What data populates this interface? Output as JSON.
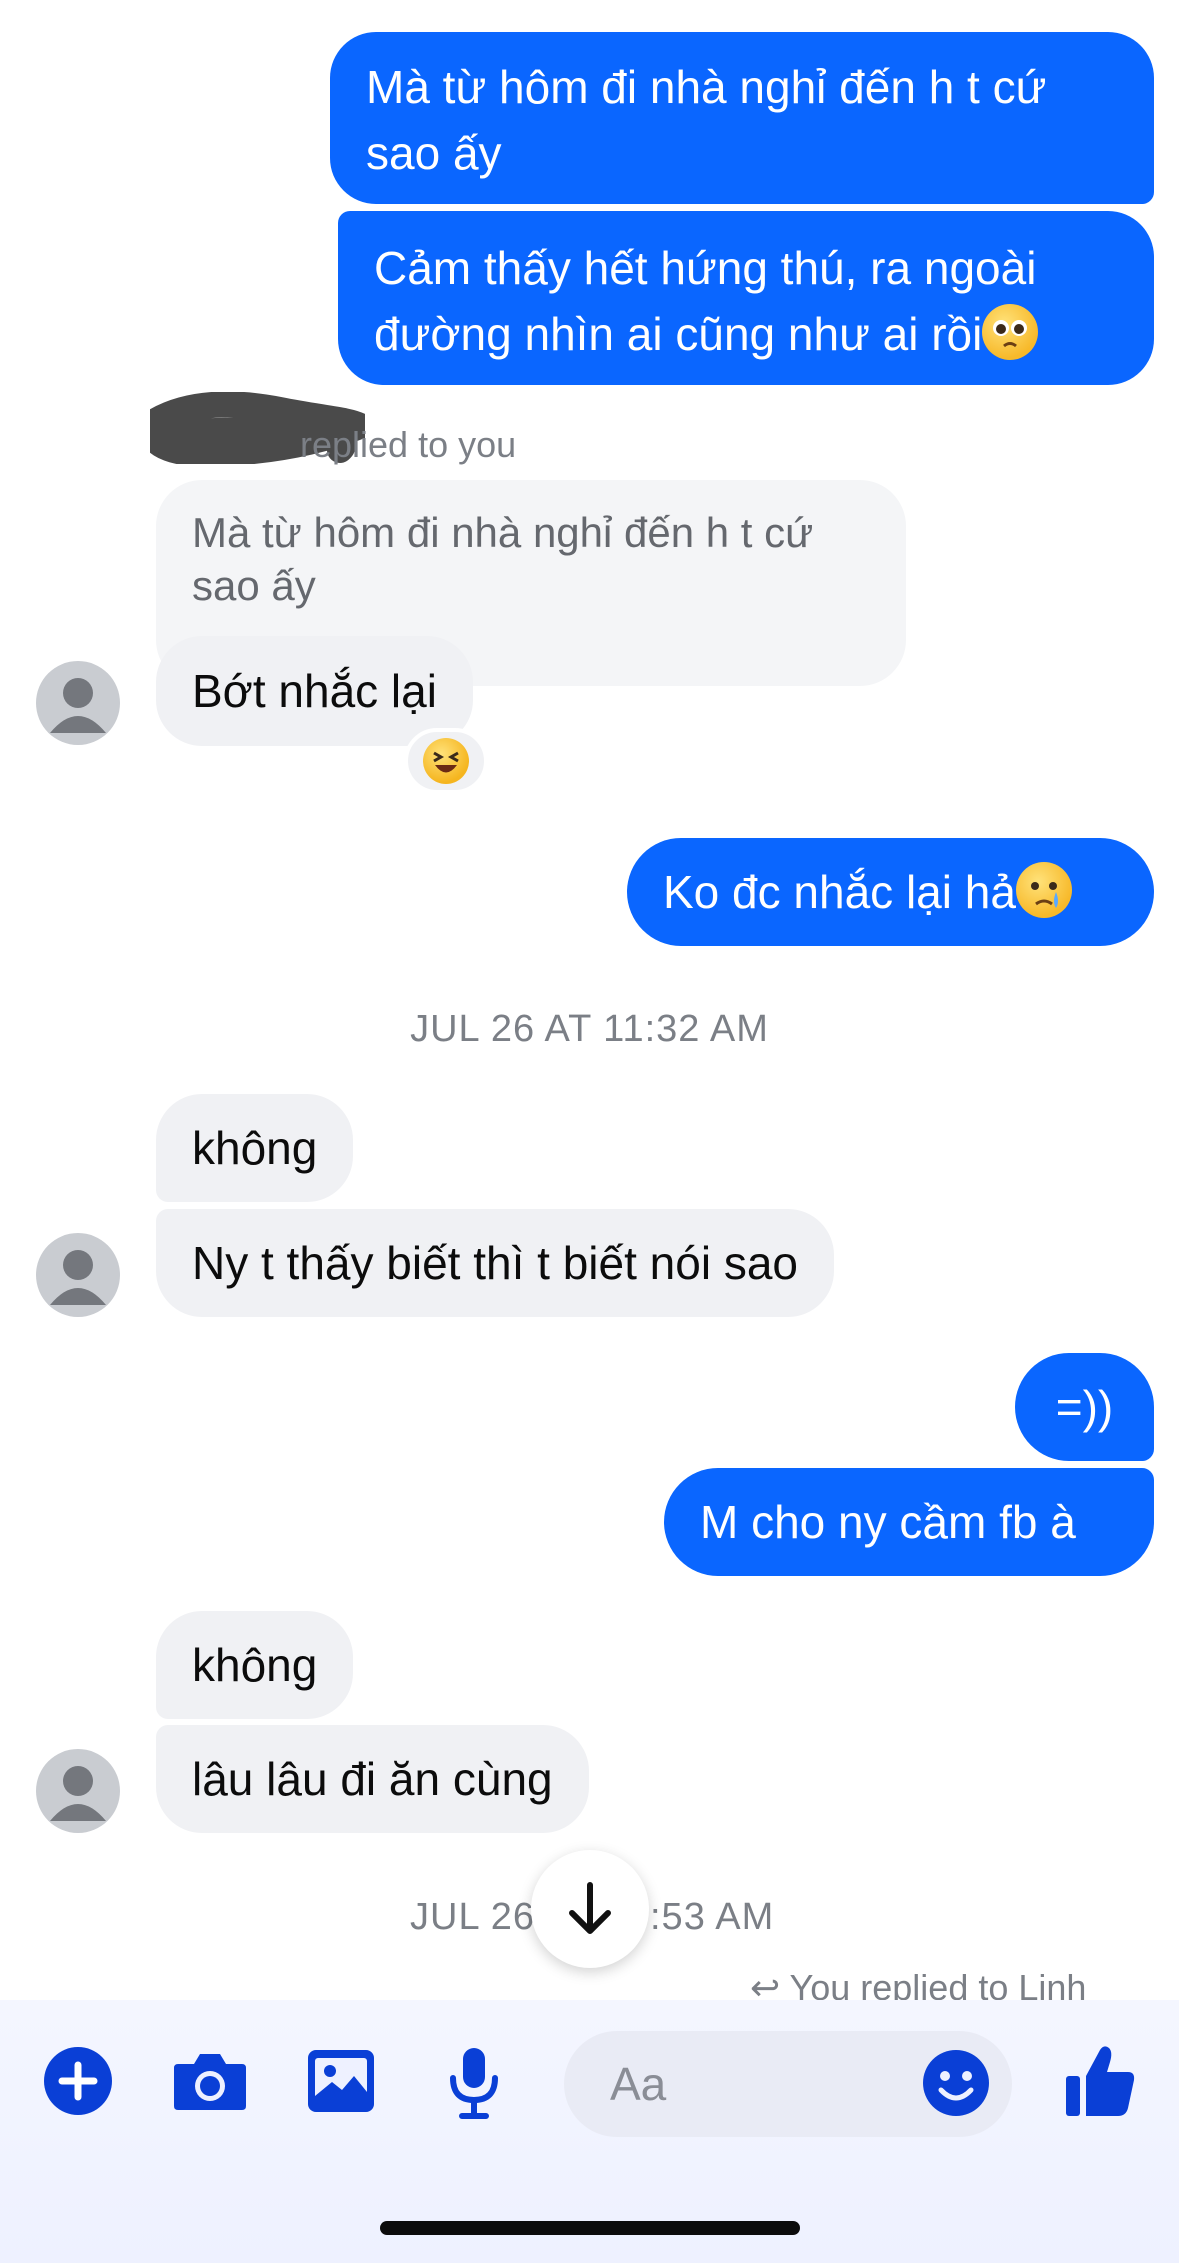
{
  "messages": {
    "out1": "Mà từ hôm đi nhà nghỉ đến h t cứ sao ấy",
    "out2_text": "Cảm thấy hết hứng thú, ra ngoài đường nhìn ai cũng như ai rồi",
    "reply_label": "replied to you",
    "quoted": "Mà từ hôm đi nhà nghỉ đến h t cứ sao ấy",
    "in1": "Bớt nhắc lại",
    "reaction": "😆",
    "out3_text": "Ko đc nhắc lại hả",
    "timestamp1": "JUL 26 AT 11:32 AM",
    "in2": "không",
    "in3": "Ny t thấy biết thì t biết nói sao",
    "out4": "=))",
    "out5": "M cho ny cầm fb à",
    "in4": "không",
    "in5": "lâu lâu đi ăn cùng",
    "timestamp2_left": "JUL 26",
    "timestamp2_right": ":53 AM",
    "partial_reply": "You replied to Linh"
  },
  "composer": {
    "placeholder": "Aa"
  },
  "colors": {
    "accent": "#0a66ff",
    "toolbar": "#0a3fd6",
    "incoming_bubble": "#f0f1f4"
  }
}
